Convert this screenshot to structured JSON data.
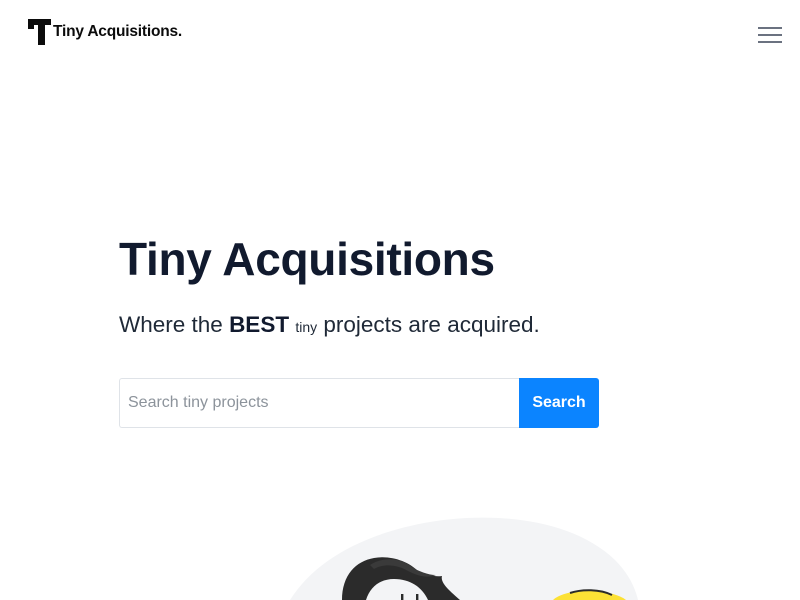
{
  "header": {
    "logo_text": "Tiny Acquisitions.",
    "logo_icon": "t-logo-icon",
    "menu_icon": "hamburger-menu-icon"
  },
  "hero": {
    "title": "Tiny Acquisitions",
    "tagline_prefix": "Where the ",
    "tagline_best": "BEST",
    "tagline_tiny": "tiny",
    "tagline_suffix": " projects are acquired."
  },
  "search": {
    "placeholder": "Search tiny projects",
    "value": "",
    "button_label": "Search"
  },
  "colors": {
    "accent": "#0b84ff",
    "title": "#111a2e",
    "blob": "#f3f4f6",
    "illustration_yellow": "#fce135"
  }
}
